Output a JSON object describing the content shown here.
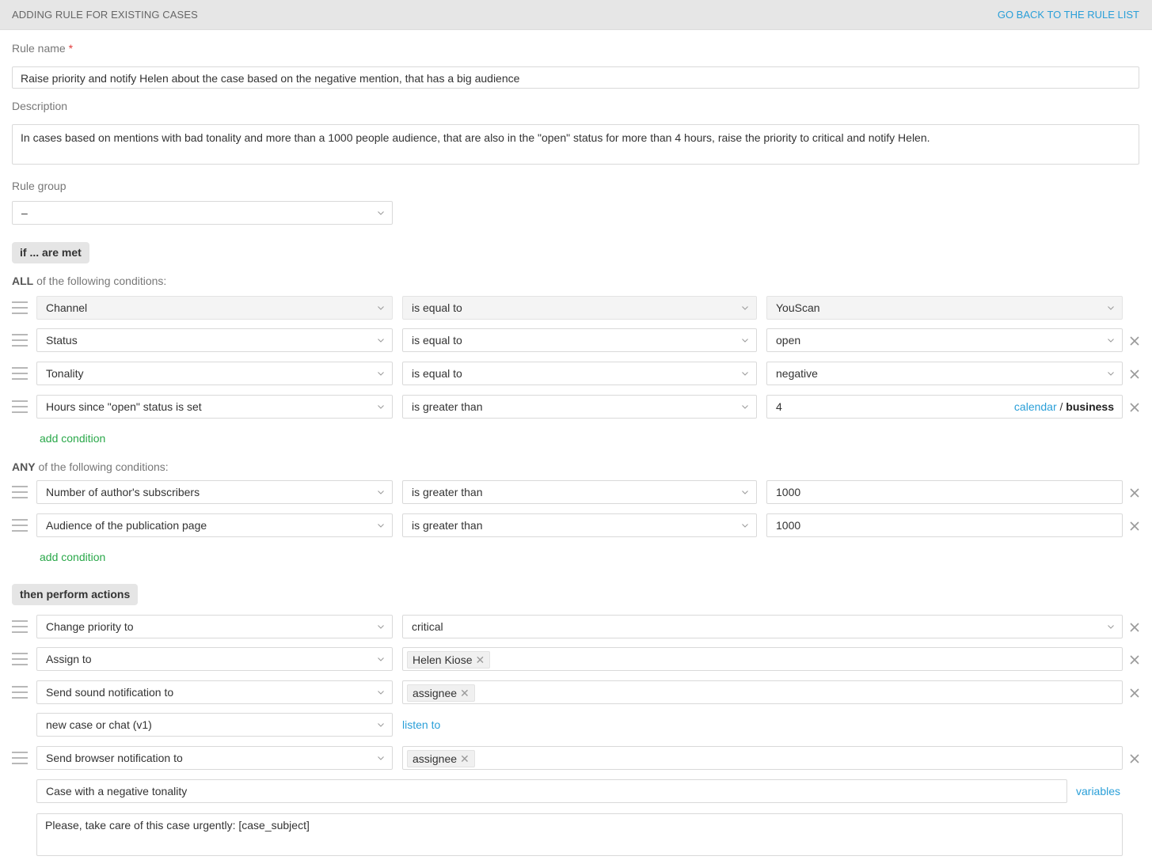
{
  "header": {
    "title": "ADDING RULE FOR EXISTING CASES",
    "back_link": "GO BACK TO THE RULE LIST"
  },
  "form": {
    "rule_name_label": "Rule name",
    "required_mark": "*",
    "rule_name_value": "Raise priority and notify Helen about the case based on the negative mention, that has a big audience",
    "description_label": "Description",
    "description_value": "In cases based on mentions with bad tonality and more than a 1000 people audience, that are also in the \"open\" status for more than 4 hours, raise the priority to critical and notify Helen.",
    "rule_group_label": "Rule group",
    "rule_group_value": "–"
  },
  "conditions": {
    "pill": "if ... are met",
    "all_head_bold": "ALL",
    "all_head_rest": " of the following conditions:",
    "all": [
      {
        "field": "Channel",
        "operator": "is equal to",
        "value": "YouScan"
      },
      {
        "field": "Status",
        "operator": "is equal to",
        "value": "open"
      },
      {
        "field": "Tonality",
        "operator": "is equal to",
        "value": "negative"
      },
      {
        "field": "Hours since \"open\" status is set",
        "operator": "is greater than",
        "value": "4",
        "calendar": "calendar",
        "separator": "/",
        "business": "business"
      }
    ],
    "add_condition": "add condition",
    "any_head_bold": "ANY",
    "any_head_rest": " of the following conditions:",
    "any": [
      {
        "field": "Number of author's subscribers",
        "operator": "is greater than",
        "value": "1000"
      },
      {
        "field": "Audience of the publication page",
        "operator": "is greater than",
        "value": "1000"
      }
    ]
  },
  "actions": {
    "pill": "then perform actions",
    "items": [
      {
        "action": "Change priority to",
        "value": "critical"
      },
      {
        "action": "Assign to",
        "tag": "Helen Kiose"
      },
      {
        "action": "Send sound notification to",
        "tag": "assignee"
      },
      {
        "action": "Send browser notification to",
        "tag": "assignee"
      }
    ],
    "sound_select": "new case or chat (v1)",
    "listen_to": "listen to",
    "browser_subject": "Case with a negative tonality",
    "variables": "variables",
    "browser_body": "Please, take care of this case urgently: [case_subject]"
  },
  "icons": {
    "chevron": "chevron-down-icon",
    "close": "close-icon",
    "handle": "drag-handle-icon"
  }
}
